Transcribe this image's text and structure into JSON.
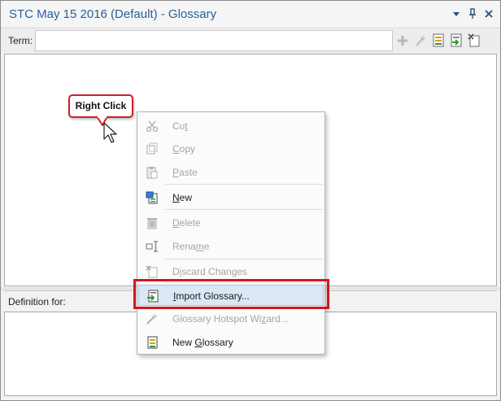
{
  "window": {
    "title": "STC May 15 2016 (Default) - Glossary",
    "controls": [
      "dropdown-icon",
      "pin-icon",
      "close-icon"
    ]
  },
  "term": {
    "label": "Term:",
    "value": "",
    "toolbar_icons": [
      "add-icon",
      "wand-icon",
      "open-glossary-icon",
      "import-glossary-icon",
      "remove-glossary-icon"
    ]
  },
  "definition": {
    "label": "Definition for:"
  },
  "callout": {
    "text": "Right Click"
  },
  "context_menu": {
    "items": [
      {
        "pre": "Cu",
        "key": "t",
        "post": "",
        "enabled": false,
        "icon": "cut-icon"
      },
      {
        "pre": "",
        "key": "C",
        "post": "opy",
        "enabled": false,
        "icon": "copy-icon"
      },
      {
        "pre": "",
        "key": "P",
        "post": "aste",
        "enabled": false,
        "icon": "paste-icon"
      },
      {
        "pre": "",
        "key": "N",
        "post": "ew",
        "enabled": true,
        "icon": "new-term-icon"
      },
      {
        "pre": "",
        "key": "D",
        "post": "elete",
        "enabled": false,
        "icon": "delete-icon"
      },
      {
        "pre": "Rena",
        "key": "m",
        "post": "e",
        "enabled": false,
        "icon": "rename-icon"
      },
      {
        "pre": "D",
        "key": "i",
        "post": "scard Changes",
        "enabled": false,
        "icon": "discard-icon"
      },
      {
        "pre": "",
        "key": "I",
        "post": "mport Glossary...",
        "enabled": true,
        "icon": "import-glossary-icon",
        "highlighted": true
      },
      {
        "pre": "Glossary Hotspot Wi",
        "key": "z",
        "post": "ard...",
        "enabled": false,
        "icon": "wizard-icon"
      },
      {
        "pre": "New ",
        "key": "G",
        "post": "lossary",
        "enabled": true,
        "icon": "new-glossary-icon"
      }
    ]
  },
  "colors": {
    "title_text": "#2a6099",
    "callout_border": "#cc1f2a",
    "highlight_box": "#d0161f",
    "disabled_text": "#a5a5a5"
  }
}
